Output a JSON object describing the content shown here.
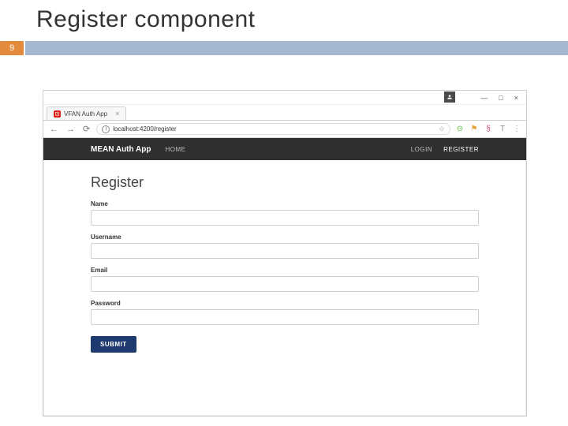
{
  "slide": {
    "title": "Register component",
    "page_number": "9"
  },
  "browser": {
    "window_controls": {
      "min": "—",
      "max": "□",
      "close": "×"
    },
    "tab": {
      "title": "VFAN Auth App",
      "close": "×"
    },
    "address": {
      "url": "localhost:4200/register",
      "info_glyph": "i",
      "star_glyph": "☆"
    },
    "nav_arrows": {
      "back": "←",
      "forward": "→",
      "reload": "⟳"
    },
    "ext_icons": {
      "a": "⊝",
      "b": "⚑",
      "c": "§",
      "d": "T",
      "e": "⋮"
    }
  },
  "app": {
    "brand": "MEAN Auth App",
    "nav": {
      "home": "HOME",
      "login": "LOGIN",
      "register": "REGISTER"
    },
    "heading": "Register",
    "fields": {
      "name_label": "Name",
      "username_label": "Username",
      "email_label": "Email",
      "password_label": "Password"
    },
    "submit_label": "SUBMIT"
  }
}
